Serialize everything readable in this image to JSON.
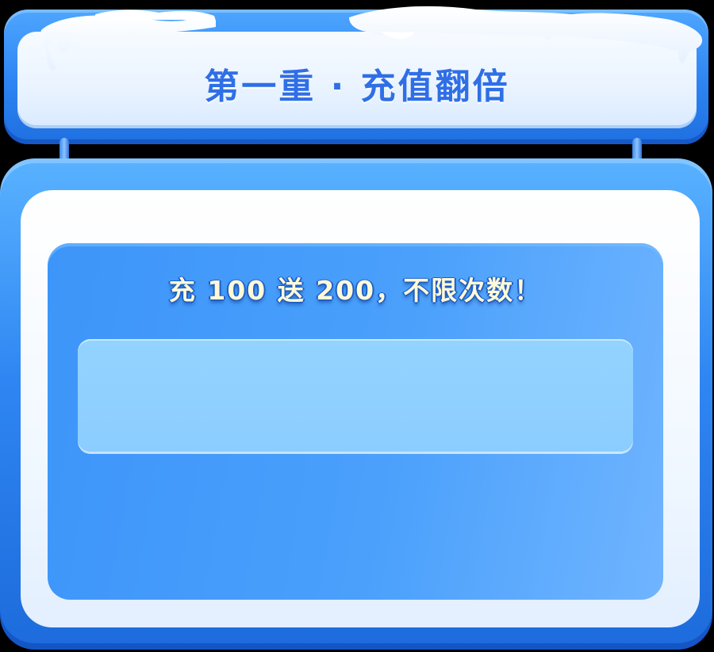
{
  "header": {
    "title": "第一重 · 充值翻倍"
  },
  "offer": {
    "text": "充 100 送 200，不限次数！"
  },
  "colors": {
    "frame_blue": "#2d84f2",
    "title_blue": "#2f6fe6",
    "inner_blue": "#4aa0fb",
    "slot_blue": "#8bcdff",
    "offer_text": "#fff9d8"
  },
  "icons": {
    "snow": "snow-cap-icon"
  }
}
